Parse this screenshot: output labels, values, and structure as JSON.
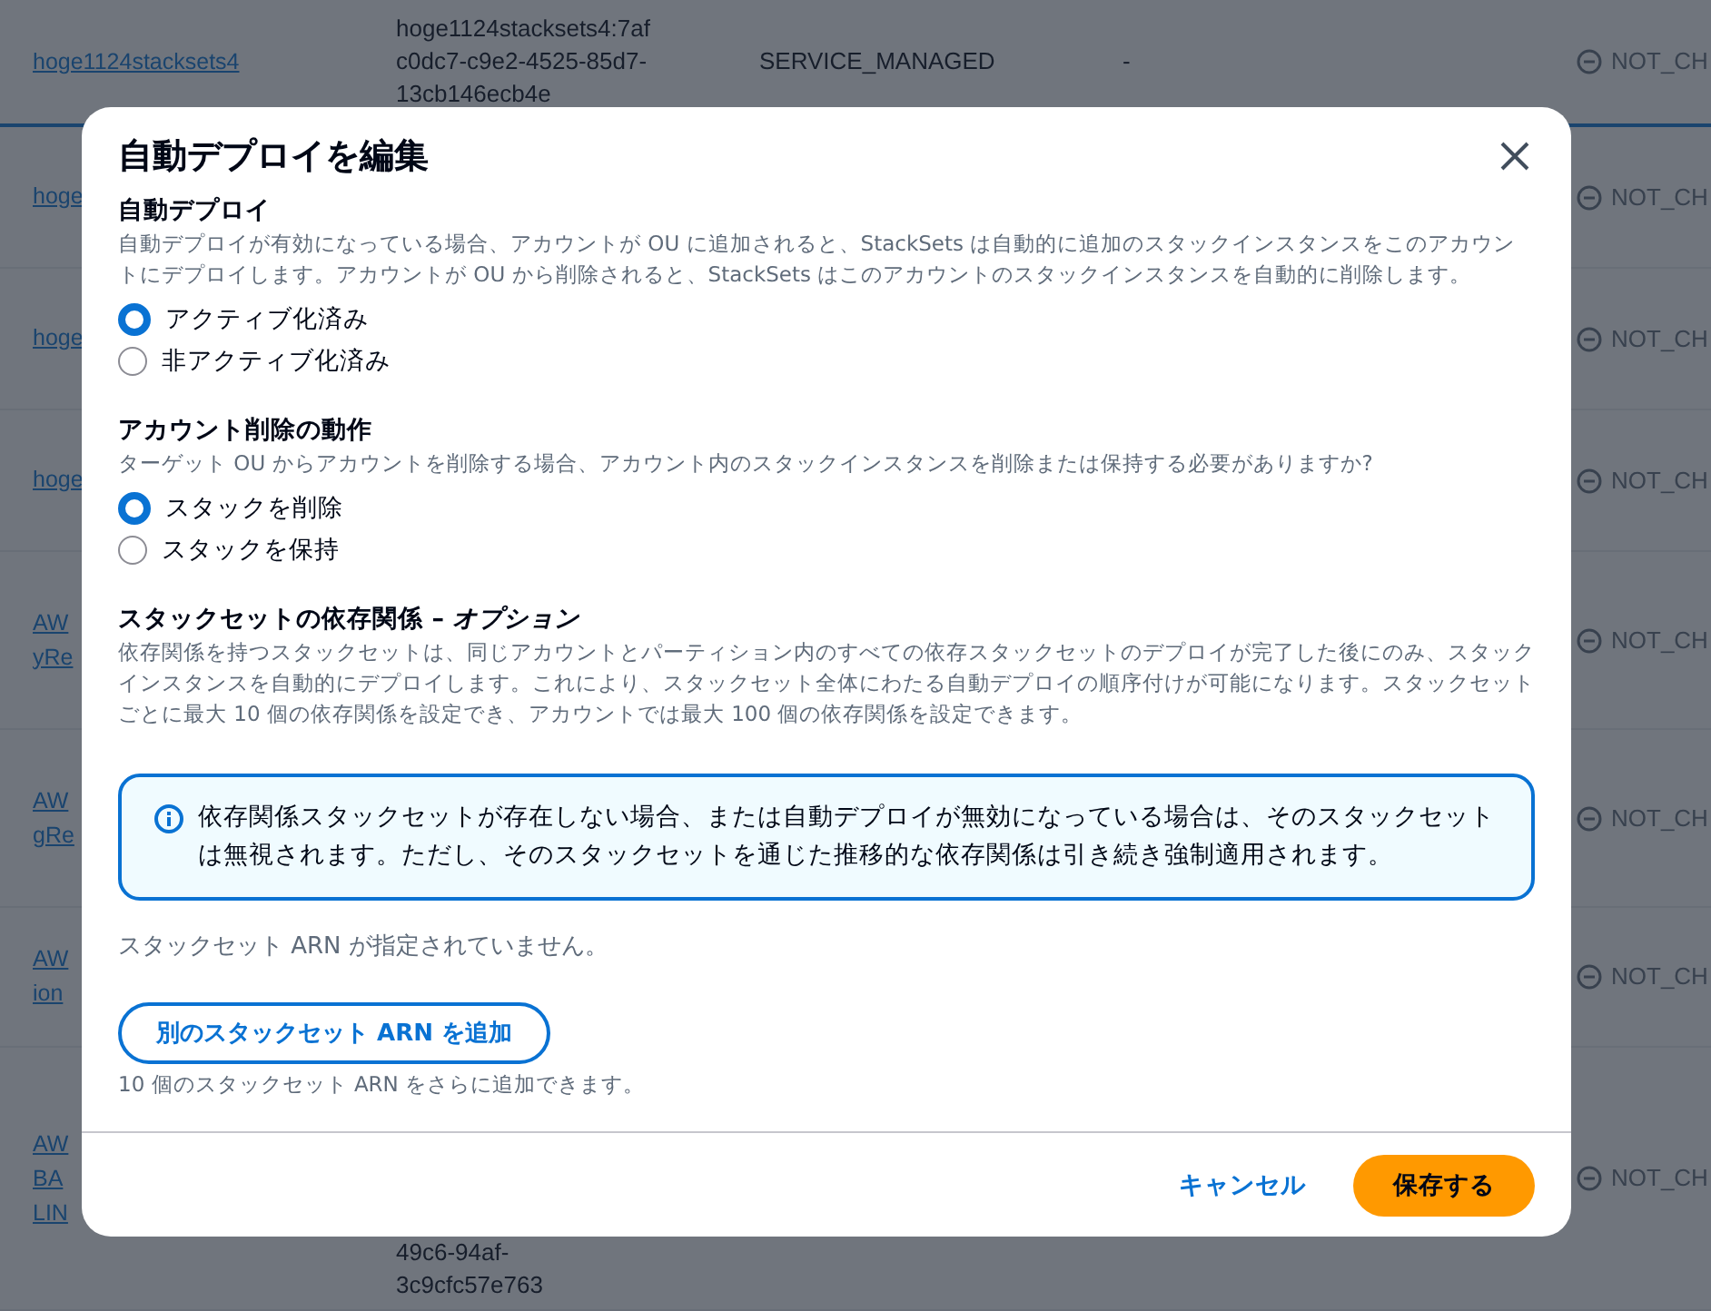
{
  "background_table": {
    "rows": [
      {
        "name": [
          "hoge1124stacksets4"
        ],
        "id": [
          "hoge1124stacksets4:7af",
          "c0dc7-c9e2-4525-85d7-",
          "13cb146ecb4e"
        ],
        "type": "SERVICE_MANAGED",
        "column_4": "-",
        "status": "NOT_CH",
        "highlighted": true
      },
      {
        "name": [
          "hoge"
        ],
        "id": [],
        "type": "",
        "column_4": "",
        "status": "NOT_CH",
        "highlighted": false
      },
      {
        "name": [
          "hoge"
        ],
        "id": [],
        "type": "",
        "column_4": "",
        "status": "NOT_CH",
        "highlighted": false
      },
      {
        "name": [
          "hoge"
        ],
        "id": [],
        "type": "",
        "column_4": "",
        "status": "NOT_CH",
        "highlighted": false
      },
      {
        "name": [
          "AW",
          "yRe"
        ],
        "id": [],
        "type": "",
        "column_4": "",
        "status": "NOT_CH",
        "highlighted": false
      },
      {
        "name": [
          "AW",
          "gRe"
        ],
        "id": [],
        "type": "",
        "column_4": "",
        "status": "NOT_CH",
        "highlighted": false
      },
      {
        "name": [
          "AW",
          "ion"
        ],
        "id": [],
        "type": "",
        "column_4": "",
        "status": "NOT_CH",
        "highlighted": false
      },
      {
        "name": [
          "AW",
          "BA",
          "LIN"
        ],
        "id": [
          "49c6-94af-",
          "3c9cfc57e763"
        ],
        "type": "",
        "column_4": "",
        "status": "NOT_CH",
        "highlighted": false
      }
    ]
  },
  "modal": {
    "title": "自動デプロイを編集",
    "sections": [
      {
        "kind": "radio",
        "heading": "自動デプロイ",
        "description": "自動デプロイが有効になっている場合、アカウントが OU に追加されると、StackSets は自動的に追加のスタックインスタンスをこのアカウントにデプロイします。アカウントが OU から削除されると、StackSets はこのアカウントのスタックインスタンスを自動的に削除します。",
        "options": [
          {
            "label": "アクティブ化済み",
            "selected": true
          },
          {
            "label": "非アクティブ化済み",
            "selected": false
          }
        ]
      },
      {
        "kind": "radio",
        "heading": "アカウント削除の動作",
        "description": "ターゲット OU からアカウントを削除する場合、アカウント内のスタックインスタンスを削除または保持する必要がありますか?",
        "options": [
          {
            "label": "スタックを削除",
            "selected": true
          },
          {
            "label": "スタックを保持",
            "selected": false
          }
        ]
      },
      {
        "kind": "dependencies",
        "heading": "スタックセットの依存関係 – *オプション*",
        "description": "依存関係を持つスタックセットは、同じアカウントとパーティション内のすべての依存スタックセットのデプロイが完了した後にのみ、スタックインスタンスを自動的にデプロイします。これにより、スタックセット全体にわたる自動デプロイの順序付けが可能になります。スタックセットごとに最大 10 個の依存関係を設定でき、アカウントでは最大 100 個の依存関係を設定できます。",
        "alert": "依存関係スタックセットが存在しない場合、または自動デプロイが無効になっている場合は、そのスタックセットは無視されます。ただし、そのスタックセットを通じた推移的な依存関係は引き続き強制適用されます。",
        "empty_text": "スタックセット ARN が指定されていません。",
        "add_button": "別のスタックセット ARN を追加",
        "hint": "10 個のスタックセット ARN をさらに追加できます。"
      }
    ],
    "footer": {
      "cancel": "キャンセル",
      "save": "保存する"
    }
  }
}
